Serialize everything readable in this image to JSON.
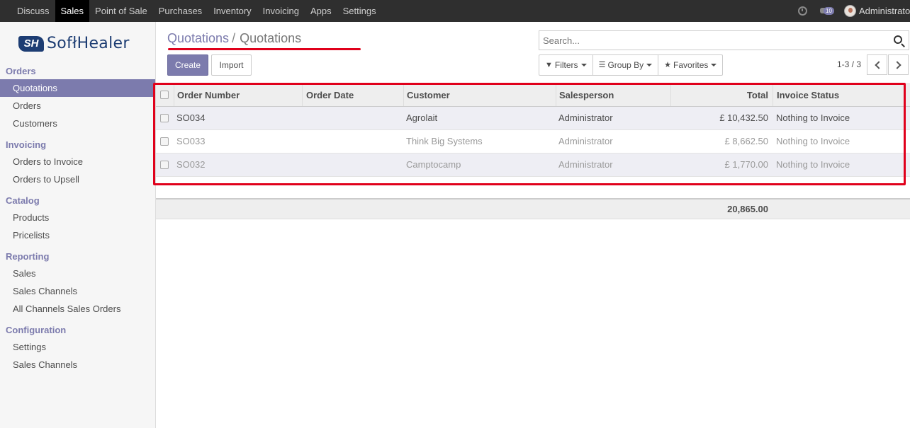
{
  "topbar": {
    "menu": [
      "Discuss",
      "Sales",
      "Point of Sale",
      "Purchases",
      "Inventory",
      "Invoicing",
      "Apps",
      "Settings"
    ],
    "active": "Sales",
    "message_count": "10",
    "user": "Administrator"
  },
  "logo": {
    "mark": "SH",
    "text": "SofłHealer"
  },
  "sidebar": {
    "orders": {
      "head": "Orders",
      "items": [
        "Quotations",
        "Orders",
        "Customers"
      ]
    },
    "invoicing": {
      "head": "Invoicing",
      "items": [
        "Orders to Invoice",
        "Orders to Upsell"
      ]
    },
    "catalog": {
      "head": "Catalog",
      "items": [
        "Products",
        "Pricelists"
      ]
    },
    "reporting": {
      "head": "Reporting",
      "items": [
        "Sales",
        "Sales Channels",
        "All Channels Sales Orders"
      ]
    },
    "configuration": {
      "head": "Configuration",
      "items": [
        "Settings",
        "Sales Channels"
      ]
    }
  },
  "breadcrumb": {
    "parent": "Quotations",
    "separator": "/",
    "current": "Quotations"
  },
  "buttons": {
    "create": "Create",
    "import": "Import"
  },
  "search": {
    "placeholder": "Search..."
  },
  "filters": {
    "filters": "Filters",
    "group_by": "Group By",
    "favorites": "Favorites"
  },
  "pager": {
    "text": "1-3 / 3"
  },
  "table": {
    "columns": [
      "Order Number",
      "Order Date",
      "Customer",
      "Salesperson",
      "Total",
      "Invoice Status"
    ],
    "rows": [
      {
        "number": "SO034",
        "date": "",
        "customer": "Agrolait",
        "salesperson": "Administrator",
        "total": "£ 10,432.50",
        "status": "Nothing to Invoice"
      },
      {
        "number": "SO033",
        "date": "",
        "customer": "Think Big Systems",
        "salesperson": "Administrator",
        "total": "£ 8,662.50",
        "status": "Nothing to Invoice"
      },
      {
        "number": "SO032",
        "date": "",
        "customer": "Camptocamp",
        "salesperson": "Administrator",
        "total": "£ 1,770.00",
        "status": "Nothing to Invoice"
      }
    ],
    "grand_total": "20,865.00"
  },
  "colors": {
    "accent": "#7c7bad",
    "highlight": "#e0001b",
    "navbar": "#2f2f2f"
  }
}
